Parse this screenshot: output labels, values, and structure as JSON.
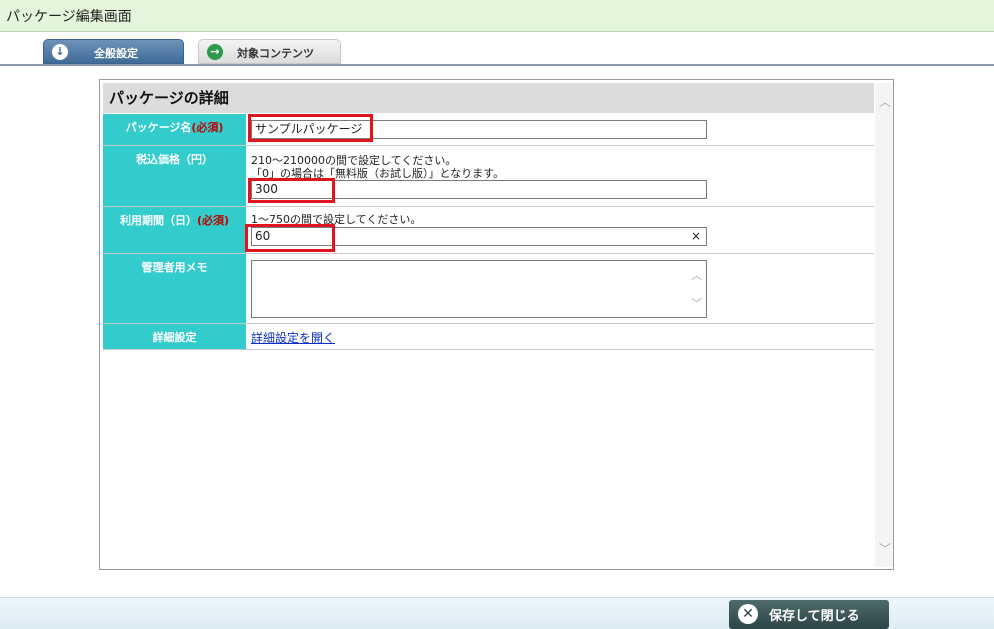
{
  "window": {
    "title": "パッケージ編集画面"
  },
  "tabs": [
    {
      "label": "全般設定",
      "icon": "arrow-down-circle-icon",
      "active": true
    },
    {
      "label": "対象コンテンツ",
      "icon": "arrow-right-circle-icon",
      "active": false
    }
  ],
  "panel": {
    "title": "パッケージの詳細",
    "rows": {
      "name": {
        "label": "パッケージ名",
        "required": "(必須)",
        "value": "サンプルパッケージ"
      },
      "price": {
        "label": "税込価格（円）",
        "note1": "210～210000の間で設定してください。",
        "note2": "「0」の場合は「無料版（お試し版）」となります。",
        "value": "300"
      },
      "period": {
        "label": "利用期間（日）",
        "required": "(必須)",
        "note": "1～750の間で設定してください。",
        "value": "60",
        "clear_icon": "×"
      },
      "memo": {
        "label": "管理者用メモ",
        "value": ""
      },
      "detail": {
        "label": "詳細設定",
        "link": "詳細設定を開く"
      }
    }
  },
  "footer": {
    "save_close_label": "保存して閉じる"
  },
  "colors": {
    "label_bg": "#33cccc",
    "required": "#c00000",
    "highlight": "#e0141e",
    "tab_active": "#3f6b97"
  }
}
